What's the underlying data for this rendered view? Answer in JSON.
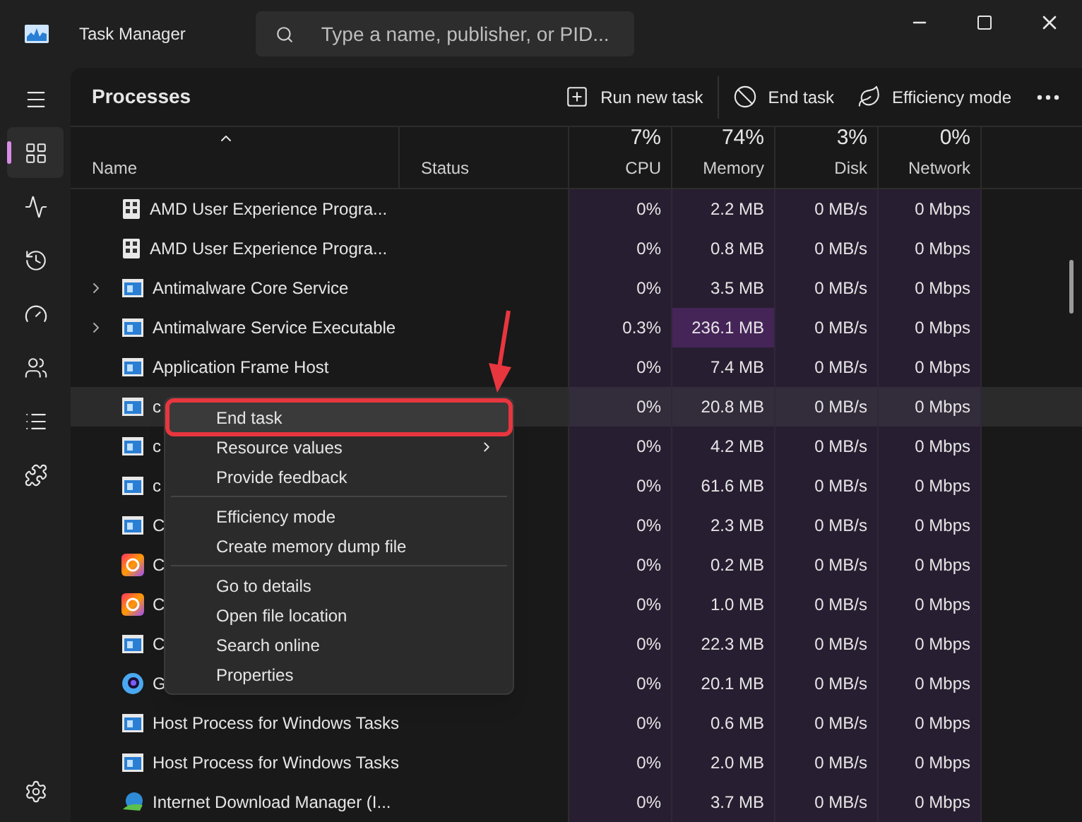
{
  "window": {
    "title": "Task Manager"
  },
  "search": {
    "placeholder": "Type a name, publisher, or PID..."
  },
  "sidebar": {
    "items": [
      {
        "kind": "menu",
        "selected": false
      },
      {
        "kind": "processes",
        "selected": true
      },
      {
        "kind": "performance",
        "selected": false
      },
      {
        "kind": "history",
        "selected": false
      },
      {
        "kind": "startup",
        "selected": false
      },
      {
        "kind": "users",
        "selected": false
      },
      {
        "kind": "details",
        "selected": false
      },
      {
        "kind": "services",
        "selected": false
      },
      {
        "kind": "settings",
        "selected": false
      }
    ]
  },
  "toolbar": {
    "title": "Processes",
    "buttons": [
      {
        "kind": "run",
        "label": "Run new task"
      },
      {
        "kind": "end",
        "label": "End task"
      },
      {
        "kind": "efficiency",
        "label": "Efficiency mode"
      }
    ]
  },
  "table": {
    "columns": [
      {
        "label": "Name"
      },
      {
        "label": "Status"
      },
      {
        "usage": "7%",
        "label": "CPU"
      },
      {
        "usage": "74%",
        "label": "Memory"
      },
      {
        "usage": "3%",
        "label": "Disk"
      },
      {
        "usage": "0%",
        "label": "Network"
      }
    ],
    "rows": [
      {
        "kind": "amd",
        "expandable": false,
        "selected": false,
        "name": "AMD User Experience Progra...",
        "cpu": "0%",
        "memory": "2.2 MB",
        "memory_high": false,
        "disk": "0 MB/s",
        "network": "0 Mbps"
      },
      {
        "kind": "amd",
        "expandable": false,
        "selected": false,
        "name": "AMD User Experience Progra...",
        "cpu": "0%",
        "memory": "0.8 MB",
        "memory_high": false,
        "disk": "0 MB/s",
        "network": "0 Mbps"
      },
      {
        "kind": "app",
        "expandable": true,
        "selected": false,
        "name": "Antimalware Core Service",
        "cpu": "0%",
        "memory": "3.5 MB",
        "memory_high": false,
        "disk": "0 MB/s",
        "network": "0 Mbps"
      },
      {
        "kind": "app",
        "expandable": true,
        "selected": false,
        "name": "Antimalware Service Executable",
        "cpu": "0.3%",
        "memory": "236.1 MB",
        "memory_high": true,
        "disk": "0 MB/s",
        "network": "0 Mbps"
      },
      {
        "kind": "app",
        "expandable": false,
        "selected": false,
        "name": "Application Frame Host",
        "cpu": "0%",
        "memory": "7.4 MB",
        "memory_high": false,
        "disk": "0 MB/s",
        "network": "0 Mbps"
      },
      {
        "kind": "app",
        "expandable": false,
        "selected": true,
        "name": "c",
        "cpu": "0%",
        "memory": "20.8 MB",
        "memory_high": false,
        "disk": "0 MB/s",
        "network": "0 Mbps"
      },
      {
        "kind": "app",
        "expandable": false,
        "selected": false,
        "name": "c",
        "cpu": "0%",
        "memory": "4.2 MB",
        "memory_high": false,
        "disk": "0 MB/s",
        "network": "0 Mbps"
      },
      {
        "kind": "app",
        "expandable": false,
        "selected": false,
        "name": "c",
        "cpu": "0%",
        "memory": "61.6 MB",
        "memory_high": false,
        "disk": "0 MB/s",
        "network": "0 Mbps"
      },
      {
        "kind": "app",
        "expandable": false,
        "selected": false,
        "name": "C",
        "cpu": "0%",
        "memory": "2.3 MB",
        "memory_high": false,
        "disk": "0 MB/s",
        "network": "0 Mbps"
      },
      {
        "kind": "rainbow",
        "expandable": false,
        "selected": false,
        "name": "C",
        "cpu": "0%",
        "memory": "0.2 MB",
        "memory_high": false,
        "disk": "0 MB/s",
        "network": "0 Mbps"
      },
      {
        "kind": "rainbow",
        "expandable": false,
        "selected": false,
        "name": "C",
        "cpu": "0%",
        "memory": "1.0 MB",
        "memory_high": false,
        "disk": "0 MB/s",
        "network": "0 Mbps"
      },
      {
        "kind": "app",
        "expandable": false,
        "selected": false,
        "name": "C",
        "cpu": "0%",
        "memory": "22.3 MB",
        "memory_high": false,
        "disk": "0 MB/s",
        "network": "0 Mbps"
      },
      {
        "kind": "ring",
        "expandable": false,
        "selected": false,
        "name": "G",
        "cpu": "0%",
        "memory": "20.1 MB",
        "memory_high": false,
        "disk": "0 MB/s",
        "network": "0 Mbps"
      },
      {
        "kind": "app",
        "expandable": false,
        "selected": false,
        "name": "Host Process for Windows Tasks",
        "cpu": "0%",
        "memory": "0.6 MB",
        "memory_high": false,
        "disk": "0 MB/s",
        "network": "0 Mbps"
      },
      {
        "kind": "app",
        "expandable": false,
        "selected": false,
        "name": "Host Process for Windows Tasks",
        "cpu": "0%",
        "memory": "2.0 MB",
        "memory_high": false,
        "disk": "0 MB/s",
        "network": "0 Mbps"
      },
      {
        "kind": "globe",
        "expandable": false,
        "selected": false,
        "name": "Internet Download Manager (I...",
        "cpu": "0%",
        "memory": "3.7 MB",
        "memory_high": false,
        "disk": "0 MB/s",
        "network": "0 Mbps"
      }
    ]
  },
  "context_menu": {
    "groups": [
      [
        {
          "label": "End task",
          "submenu": false,
          "highlighted": true
        },
        {
          "label": "Resource values",
          "submenu": true,
          "highlighted": false
        },
        {
          "label": "Provide feedback",
          "submenu": false,
          "highlighted": false
        }
      ],
      [
        {
          "label": "Efficiency mode",
          "submenu": false,
          "highlighted": false
        },
        {
          "label": "Create memory dump file",
          "submenu": false,
          "highlighted": false
        }
      ],
      [
        {
          "label": "Go to details",
          "submenu": false,
          "highlighted": false
        },
        {
          "label": "Open file location",
          "submenu": false,
          "highlighted": false
        },
        {
          "label": "Search online",
          "submenu": false,
          "highlighted": false
        },
        {
          "label": "Properties",
          "submenu": false,
          "highlighted": false
        }
      ]
    ]
  }
}
